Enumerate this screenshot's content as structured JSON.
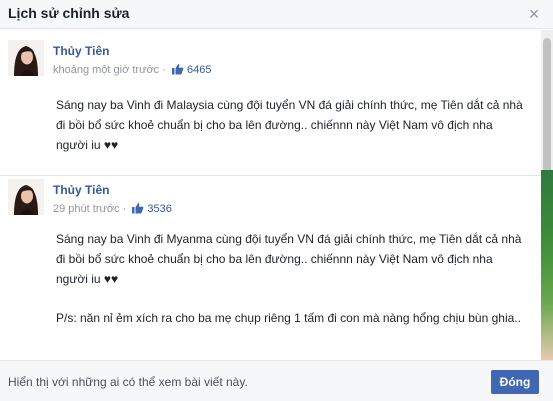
{
  "dialog": {
    "title": "Lịch sử chỉnh sửa",
    "close_glyph": "×"
  },
  "entries": [
    {
      "author": "Thủy Tiên",
      "time": "khoảng một giờ trước",
      "separator": "·",
      "likes": "6465",
      "paragraphs": [
        "Sáng nay ba Vinh đi Malaysia cùng đội tuyển VN đá giải chính thức, mẹ Tiên dắt cả nhà đi bồi bổ sức khoẻ chuẩn bị cho ba lên đường.. chiếnnn này Việt Nam vô địch nha người iu ♥♥"
      ]
    },
    {
      "author": "Thủy Tiên",
      "time": "29 phút trước",
      "separator": "·",
      "likes": "3536",
      "paragraphs": [
        "Sáng nay ba Vinh đi Myanma cùng đội tuyển VN đá giải chính thức, mẹ Tiên dắt cả nhà đi bồi bổ sức khoẻ chuẩn bị cho ba lên đường.. chiếnnn này Việt Nam vô địch nha người iu ♥♥",
        "P/s: năn nỉ ẻm xích ra cho ba mẹ chụp riêng 1 tấm đi con mà nàng hổng chịu bùn ghia.."
      ]
    }
  ],
  "footer": {
    "note": "Hiển thị với những ai có thể xem bài viết này.",
    "close_button": "Đóng"
  },
  "icons": {
    "close": "close-icon",
    "like": "thumbs-up-icon",
    "avatar": "avatar"
  },
  "colors": {
    "link": "#365899",
    "button": "#4267b2",
    "meta": "#90949c"
  }
}
